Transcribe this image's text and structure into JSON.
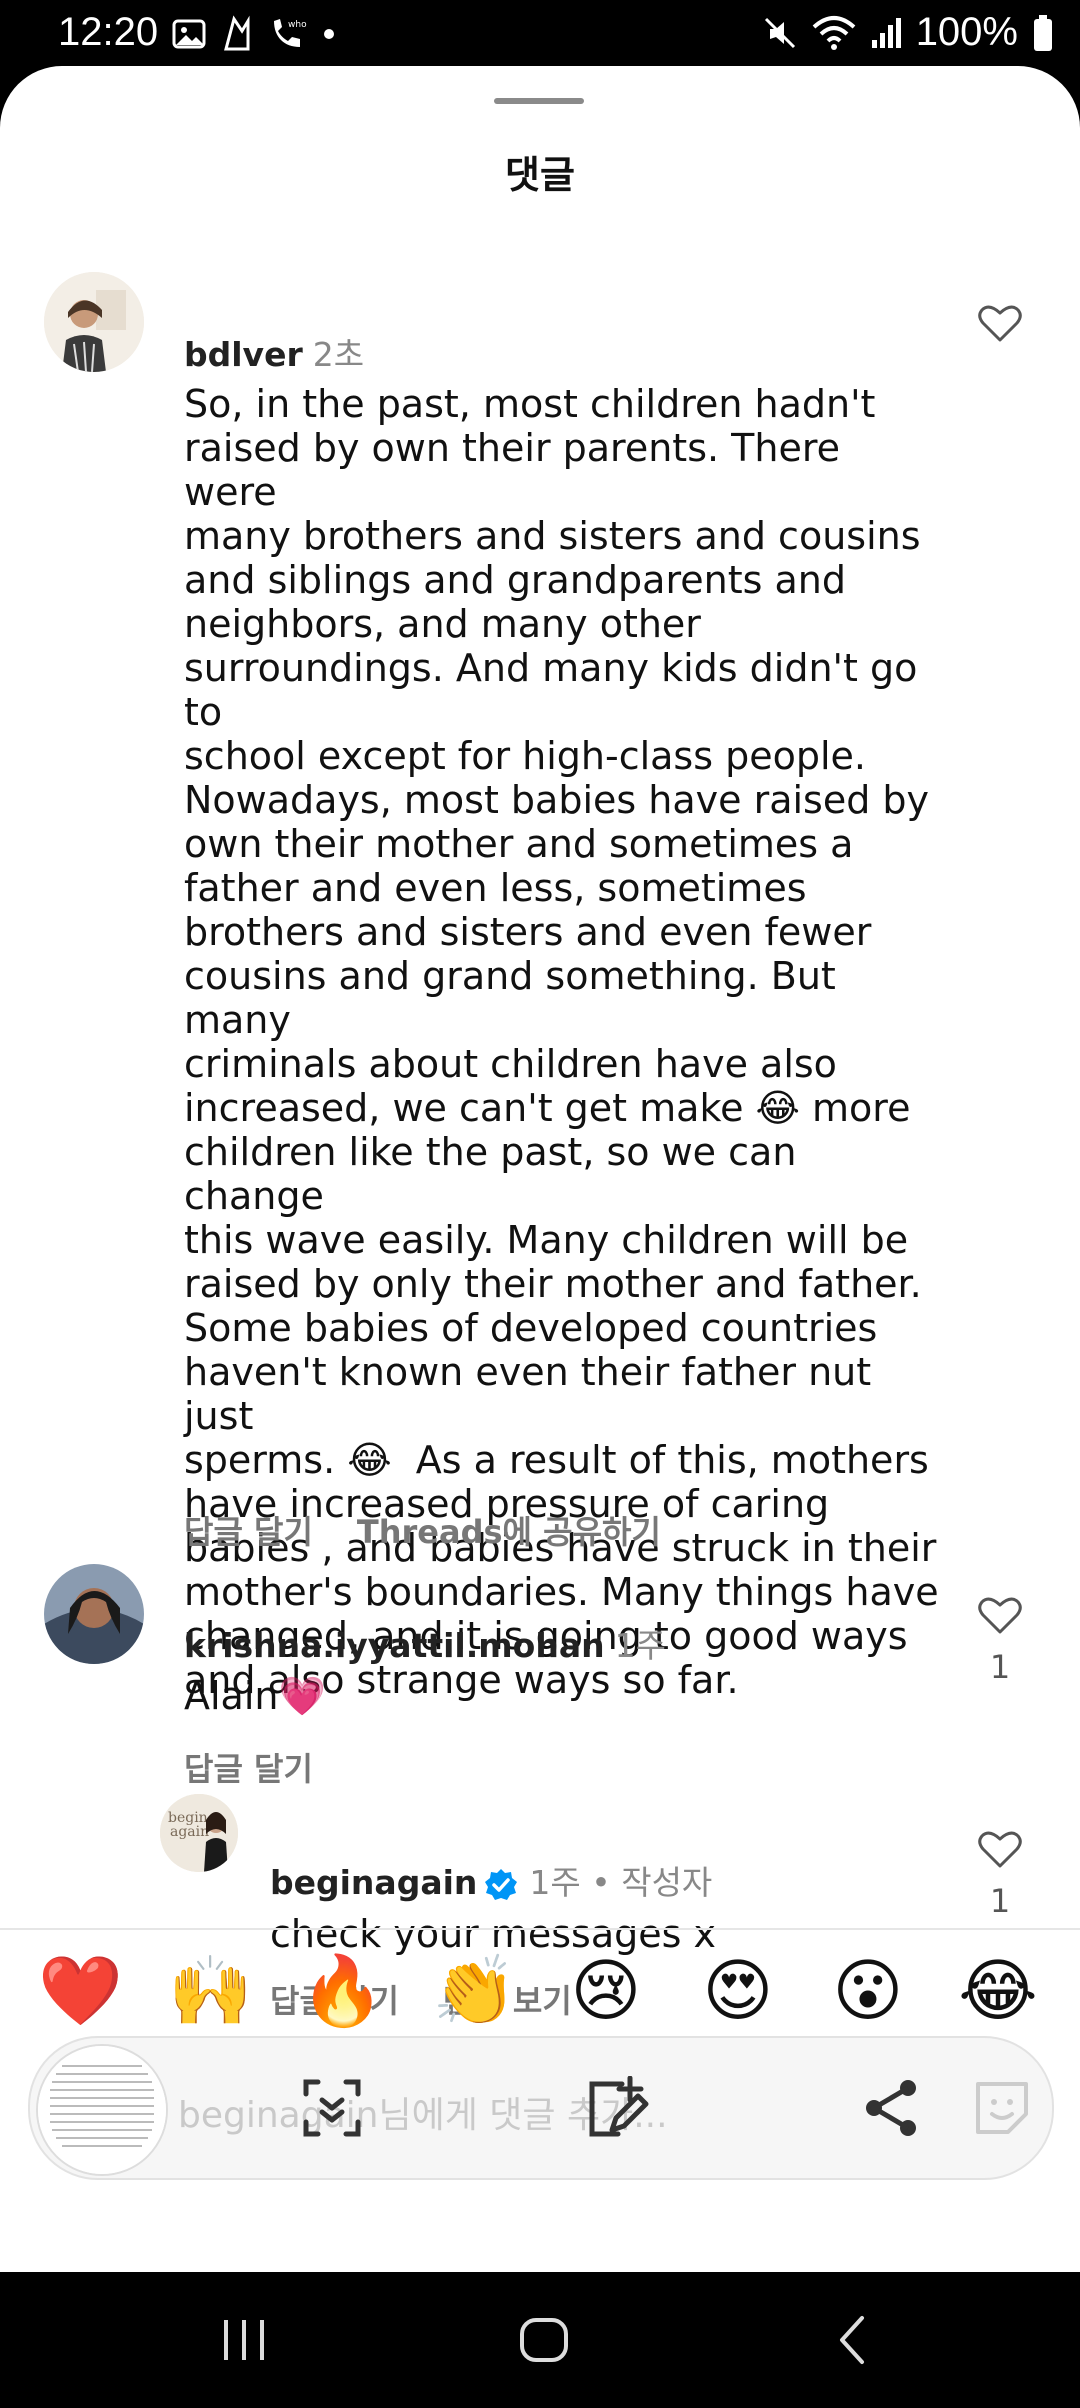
{
  "status_bar": {
    "time": "12:20",
    "battery": "100%",
    "left_icons": [
      "gallery-icon",
      "app-icon",
      "whowho-call-icon",
      "dot-icon"
    ],
    "right_icons": [
      "mute-icon",
      "wifi-icon",
      "signal-icon",
      "battery-icon"
    ]
  },
  "sheet": {
    "title": "댓글"
  },
  "comments": [
    {
      "username": "bdlver",
      "time": "2초",
      "text": "So, in the past, most children hadn't\nraised by own their parents. There were\nmany brothers and sisters and cousins\nand siblings and grandparents and\nneighbors, and many other\nsurroundings. And many kids didn't go to\nschool except for high-class people.\nNowadays, most babies have raised by\nown their mother and sometimes a\nfather and even less, sometimes\nbrothers and sisters and even fewer\ncousins and grand something. But many\ncriminals about children have also\nincreased, we can't get make 😂 more\nchildren like the past, so we can change\nthis wave easily. Many children will be\nraised by only their mother and father.\nSome babies of developed countries\nhaven't known even their father nut just\nsperms. 😂  As a result of this, mothers\nhave increased pressure of caring\nbabies , and babies have struck in their\nmother's boundaries. Many things have\nchanged, and it is going to good ways\nand also strange ways so far.",
      "actions": [
        "답글 달기",
        "Threads에 공유하기"
      ],
      "like_count": ""
    },
    {
      "username": "krishna.iyyattil.mohan",
      "time": "1주",
      "text": "Alain💗",
      "actions": [
        "답글 달기"
      ],
      "like_count": "1"
    },
    {
      "username": "beginagain",
      "time": "1주 • 작성자",
      "verified": true,
      "text": "check your messages x",
      "actions": [
        "답글 달기",
        "번역 보기"
      ],
      "like_count": "1"
    }
  ],
  "emoji_bar": [
    "❤️",
    "🙌",
    "🔥",
    "👏",
    "😢",
    "😍",
    "😮",
    "😂"
  ],
  "input": {
    "placeholder": "beginagain님에게 댓글 추가..."
  },
  "colors": {
    "accent_verified": "#0095f6",
    "heart": "#e8304a"
  },
  "nav_icons": [
    "recent-apps-icon",
    "home-icon",
    "back-icon"
  ]
}
